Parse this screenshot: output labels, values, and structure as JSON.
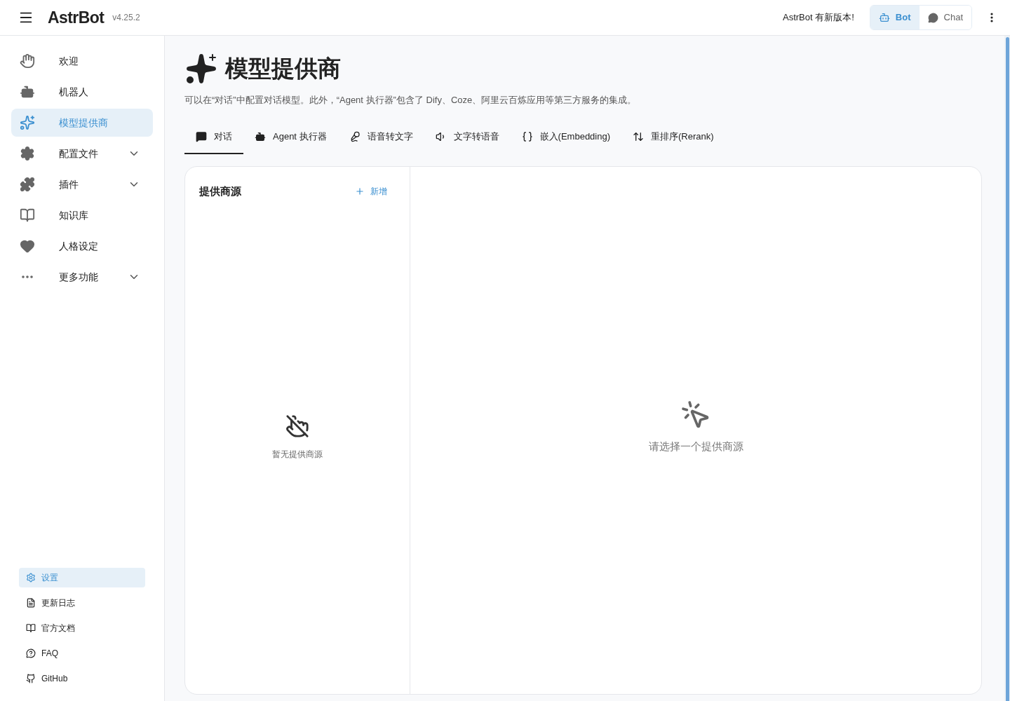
{
  "header": {
    "logo": "AstrBot",
    "version": "v4.25.2",
    "update_notice": "AstrBot 有新版本!",
    "modes": [
      {
        "label": "Bot",
        "selected": true
      },
      {
        "label": "Chat",
        "selected": false
      }
    ]
  },
  "sidebar": {
    "items": [
      {
        "label": "欢迎",
        "kind": "link",
        "selected": false
      },
      {
        "label": "机器人",
        "kind": "link",
        "selected": false
      },
      {
        "label": "模型提供商",
        "kind": "link",
        "selected": true
      },
      {
        "label": "配置文件",
        "kind": "group",
        "selected": false
      },
      {
        "label": "插件",
        "kind": "group",
        "selected": false
      },
      {
        "label": "知识库",
        "kind": "link",
        "selected": false
      },
      {
        "label": "人格设定",
        "kind": "link",
        "selected": false
      },
      {
        "label": "更多功能",
        "kind": "group",
        "selected": false
      }
    ],
    "footer_links": [
      {
        "label": "设置",
        "selected": true
      },
      {
        "label": "更新日志",
        "selected": false
      },
      {
        "label": "官方文档",
        "selected": false
      },
      {
        "label": "FAQ",
        "selected": false
      },
      {
        "label": "GitHub",
        "selected": false
      }
    ]
  },
  "page": {
    "title": "模型提供商",
    "description": "可以在“对话”中配置对话模型。此外，“Agent 执行器”包含了 Dify、Coze、阿里云百炼应用等第三方服务的集成。",
    "tabs": [
      {
        "label": "对话",
        "selected": true
      },
      {
        "label": "Agent 执行器",
        "selected": false
      },
      {
        "label": "语音转文字",
        "selected": false
      },
      {
        "label": "文字转语音",
        "selected": false
      },
      {
        "label": "嵌入(Embedding)",
        "selected": false
      },
      {
        "label": "重排序(Rerank)",
        "selected": false
      }
    ],
    "sources_panel": {
      "title": "提供商源",
      "add_button": "新增",
      "empty_text": "暂无提供商源"
    },
    "detail_panel": {
      "empty_text": "请选择一个提供商源"
    }
  }
}
